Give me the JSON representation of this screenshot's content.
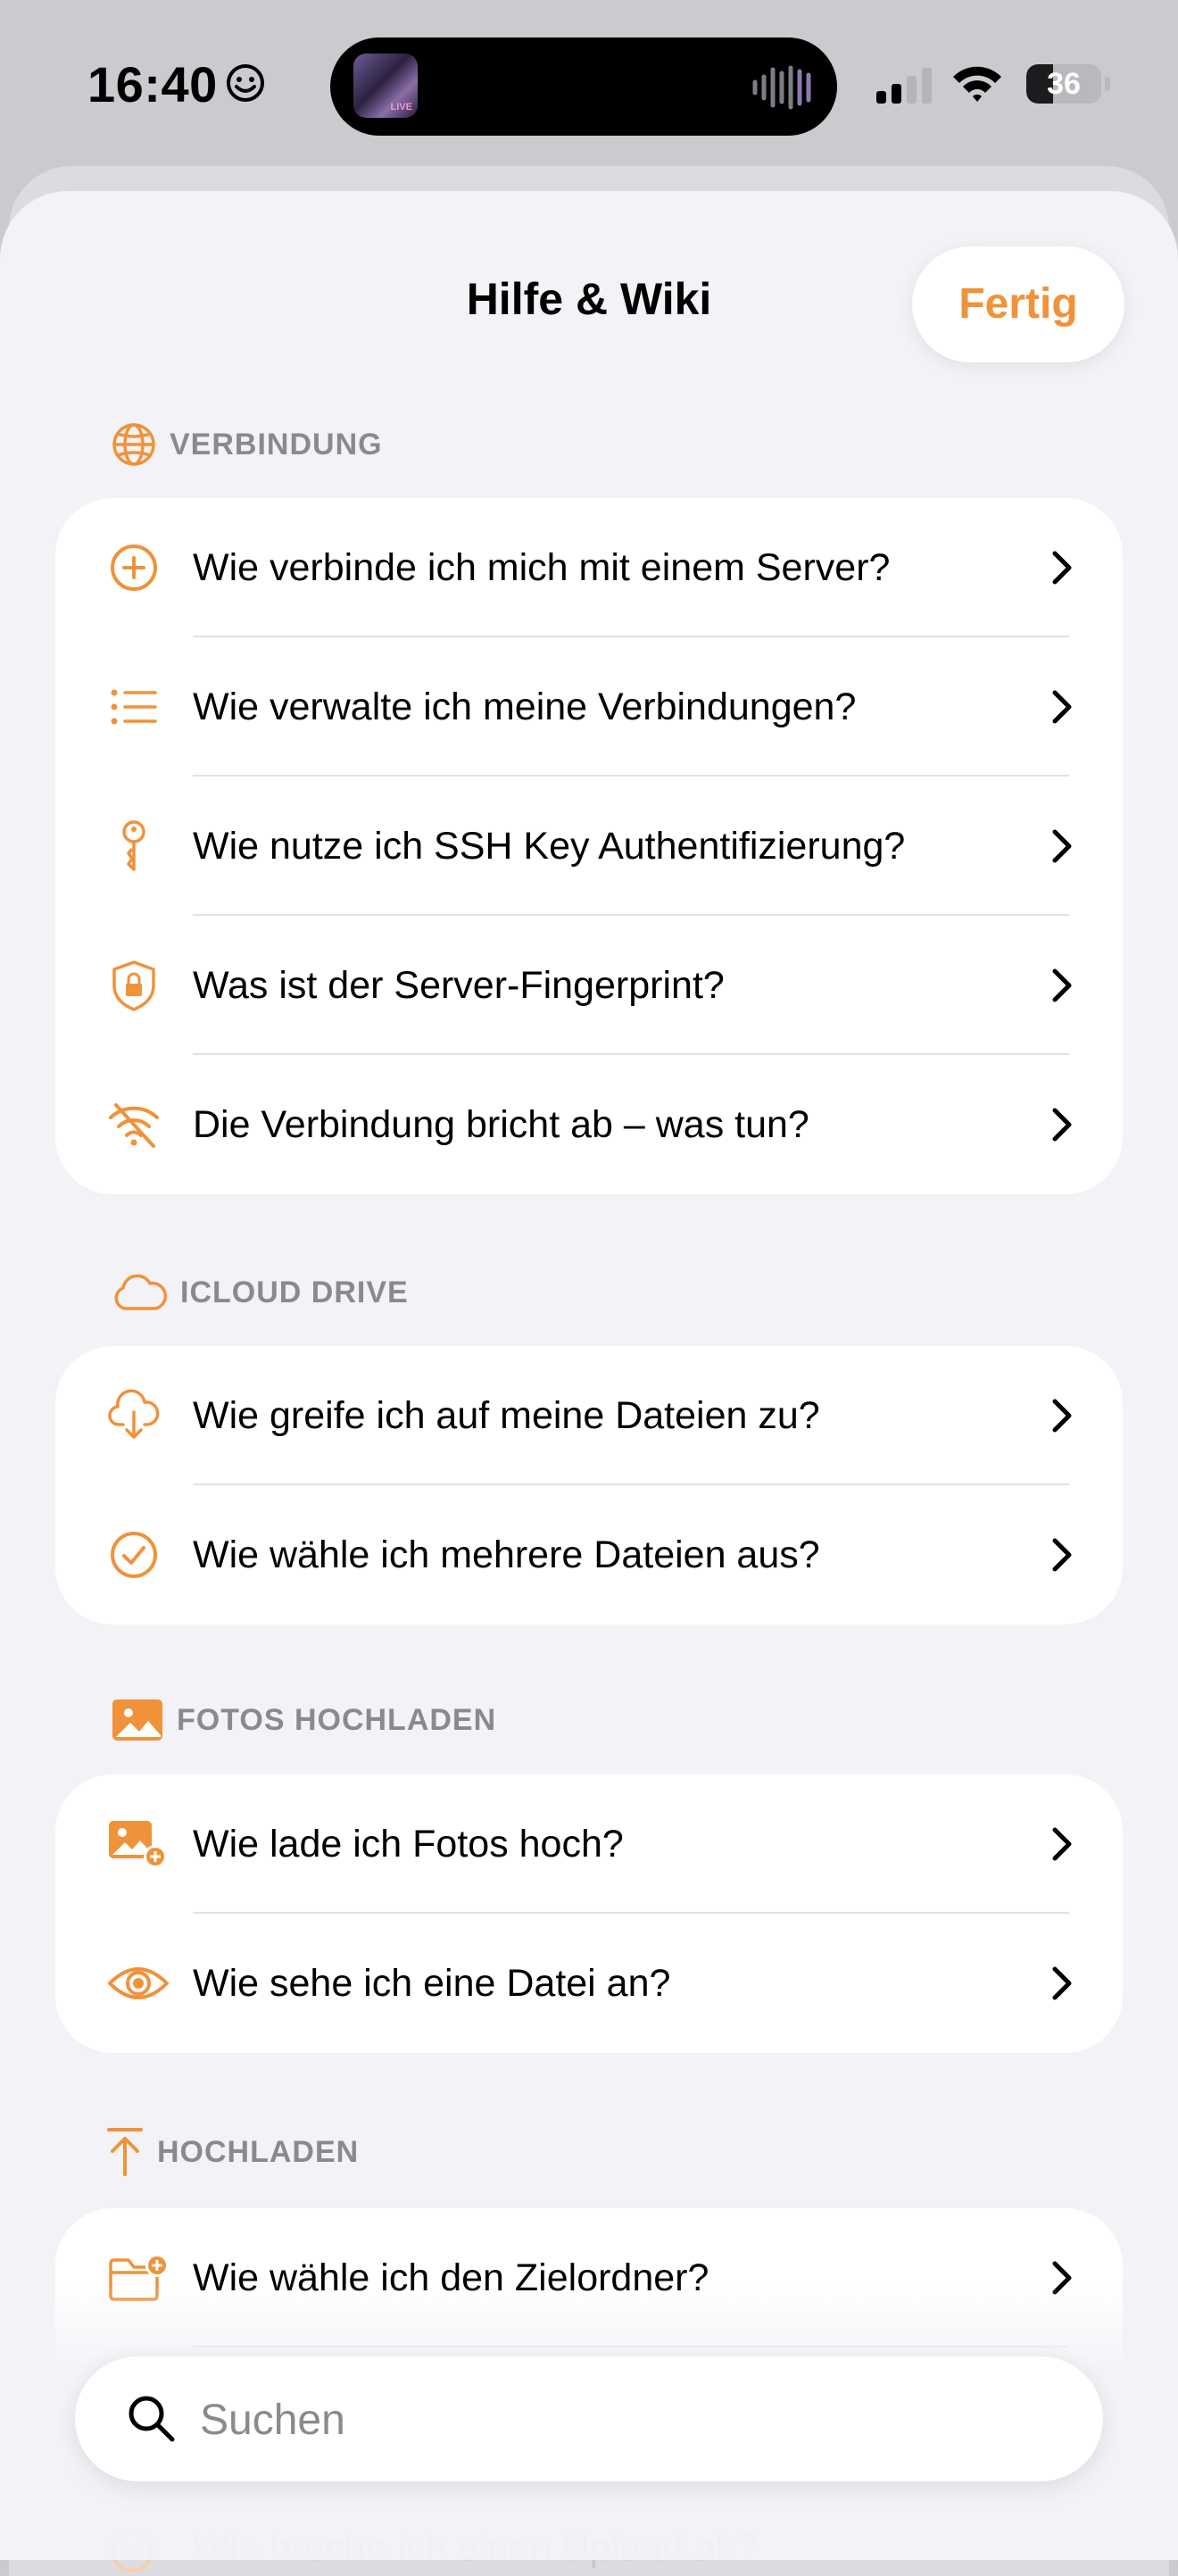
{
  "status_bar": {
    "time": "16:40",
    "battery": "36",
    "battery_level": 0.36
  },
  "sheet": {
    "title": "Hilfe & Wiki",
    "done_label": "Fertig",
    "accent_color": "#f0923a"
  },
  "sections": [
    {
      "label": "VERBINDUNG",
      "icon": "globe-icon",
      "items": [
        {
          "label": "Wie verbinde ich mich mit einem Server?",
          "icon": "plus-circle-icon"
        },
        {
          "label": "Wie verwalte ich meine Verbindungen?",
          "icon": "list-icon"
        },
        {
          "label": "Wie nutze ich SSH Key Authentifizierung?",
          "icon": "key-icon"
        },
        {
          "label": "Was ist der Server-Fingerprint?",
          "icon": "lock-shield-icon"
        },
        {
          "label": "Die Verbindung bricht ab – was tun?",
          "icon": "wifi-slash-icon"
        }
      ]
    },
    {
      "label": "ICLOUD DRIVE",
      "icon": "cloud-icon",
      "items": [
        {
          "label": "Wie greife ich auf meine Dateien zu?",
          "icon": "cloud-download-icon"
        },
        {
          "label": "Wie wähle ich mehrere Dateien aus?",
          "icon": "checkmark-circle-icon"
        }
      ]
    },
    {
      "label": "FOTOS HOCHLADEN",
      "icon": "photo-icon",
      "items": [
        {
          "label": "Wie lade ich Fotos hoch?",
          "icon": "photo-add-icon"
        },
        {
          "label": "Wie sehe ich eine Datei an?",
          "icon": "eye-icon"
        }
      ]
    },
    {
      "label": "HOCHLADEN",
      "icon": "upload-arrow-icon",
      "items": [
        {
          "label": "Wie wähle ich den Zielordner?",
          "icon": "folder-add-icon"
        },
        {
          "label": "",
          "icon": "blank"
        }
      ]
    }
  ],
  "search": {
    "placeholder": "Suchen"
  },
  "partially_hidden_item": "Wie breche ich einen Upload ab?"
}
